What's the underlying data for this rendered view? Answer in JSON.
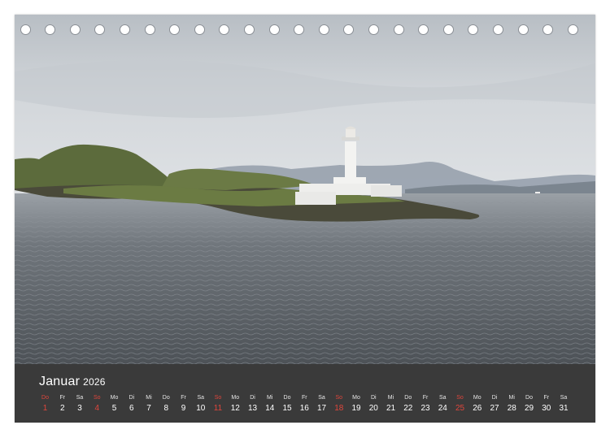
{
  "calendar": {
    "month": "Januar",
    "year": "2026",
    "days": [
      {
        "dn": "Do",
        "d": "1",
        "sun": true
      },
      {
        "dn": "Fr",
        "d": "2",
        "sun": false
      },
      {
        "dn": "Sa",
        "d": "3",
        "sun": false
      },
      {
        "dn": "So",
        "d": "4",
        "sun": true
      },
      {
        "dn": "Mo",
        "d": "5",
        "sun": false
      },
      {
        "dn": "Di",
        "d": "6",
        "sun": false
      },
      {
        "dn": "Mi",
        "d": "7",
        "sun": false
      },
      {
        "dn": "Do",
        "d": "8",
        "sun": false
      },
      {
        "dn": "Fr",
        "d": "9",
        "sun": false
      },
      {
        "dn": "Sa",
        "d": "10",
        "sun": false
      },
      {
        "dn": "So",
        "d": "11",
        "sun": true
      },
      {
        "dn": "Mo",
        "d": "12",
        "sun": false
      },
      {
        "dn": "Di",
        "d": "13",
        "sun": false
      },
      {
        "dn": "Mi",
        "d": "14",
        "sun": false
      },
      {
        "dn": "Do",
        "d": "15",
        "sun": false
      },
      {
        "dn": "Fr",
        "d": "16",
        "sun": false
      },
      {
        "dn": "Sa",
        "d": "17",
        "sun": false
      },
      {
        "dn": "So",
        "d": "18",
        "sun": true
      },
      {
        "dn": "Mo",
        "d": "19",
        "sun": false
      },
      {
        "dn": "Di",
        "d": "20",
        "sun": false
      },
      {
        "dn": "Mi",
        "d": "21",
        "sun": false
      },
      {
        "dn": "Do",
        "d": "22",
        "sun": false
      },
      {
        "dn": "Fr",
        "d": "23",
        "sun": false
      },
      {
        "dn": "Sa",
        "d": "24",
        "sun": false
      },
      {
        "dn": "So",
        "d": "25",
        "sun": true
      },
      {
        "dn": "Mo",
        "d": "26",
        "sun": false
      },
      {
        "dn": "Di",
        "d": "27",
        "sun": false
      },
      {
        "dn": "Mi",
        "d": "28",
        "sun": false
      },
      {
        "dn": "Do",
        "d": "29",
        "sun": false
      },
      {
        "dn": "Fr",
        "d": "30",
        "sun": false
      },
      {
        "dn": "Sa",
        "d": "31",
        "sun": false
      }
    ]
  },
  "binding": {
    "ring_count": 23
  },
  "colors": {
    "calendar_bar": "#3a3a3a",
    "sunday": "#e0463c",
    "sky": "#c9ced3",
    "sea": "#5e6369"
  }
}
